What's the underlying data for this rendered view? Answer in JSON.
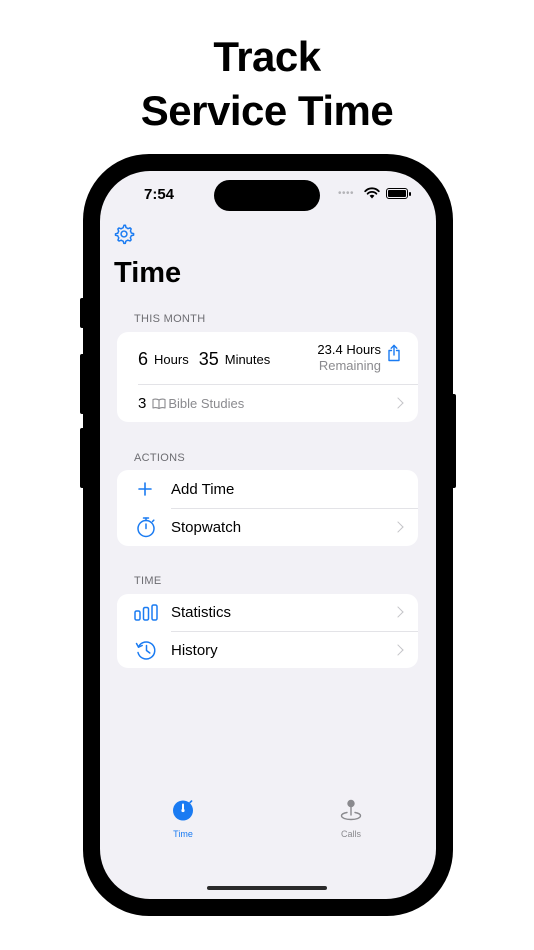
{
  "headline": {
    "line1": "Track",
    "line2": "Service Time"
  },
  "status_bar": {
    "time": "7:54",
    "signal_dots": "••••"
  },
  "page_title": "Time",
  "this_month": {
    "section_label": "THIS MONTH",
    "hours_value": "6",
    "hours_unit": "Hours",
    "minutes_value": "35",
    "minutes_unit": "Minutes",
    "remaining_value": "23.4 Hours",
    "remaining_label": "Remaining",
    "bible_studies_count": "3",
    "bible_studies_label": "Bible Studies"
  },
  "actions": {
    "section_label": "ACTIONS",
    "add_time": "Add Time",
    "stopwatch": "Stopwatch"
  },
  "time_section": {
    "section_label": "TIME",
    "statistics": "Statistics",
    "history": "History"
  },
  "tabbar": {
    "tabs": [
      {
        "label": "Time",
        "icon": "timer-icon",
        "active": true
      },
      {
        "label": "Calls",
        "icon": "map-pin-icon",
        "active": false
      }
    ]
  },
  "colors": {
    "accent": "#1a7bf2",
    "background": "#f2f1f6",
    "secondary_text": "#6d6d72"
  }
}
